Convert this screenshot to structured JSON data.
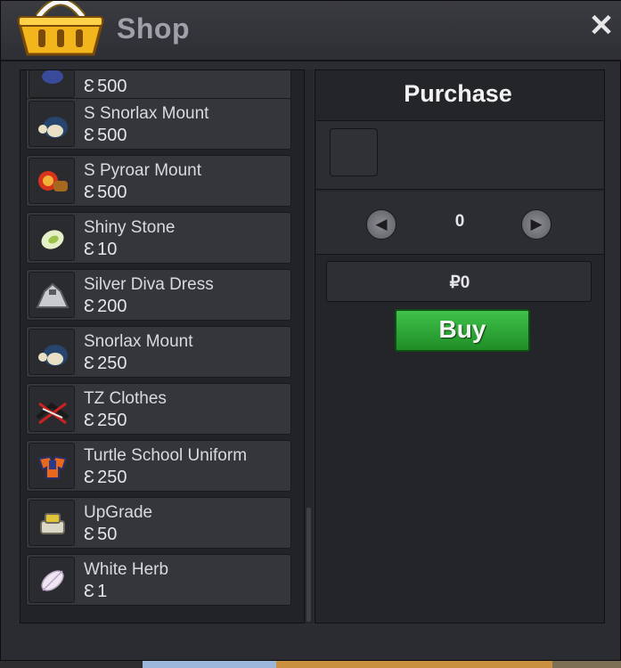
{
  "window": {
    "title": "Shop",
    "close_label": "✕"
  },
  "items": [
    {
      "name": "",
      "currency": "Ɛ",
      "price": "500",
      "icon": "pokemon-partial-icon"
    },
    {
      "name": "S Snorlax Mount",
      "currency": "Ɛ",
      "price": "500",
      "icon": "snorlax-icon"
    },
    {
      "name": "S Pyroar Mount",
      "currency": "Ɛ",
      "price": "500",
      "icon": "pyroar-icon"
    },
    {
      "name": "Shiny Stone",
      "currency": "Ɛ",
      "price": "10",
      "icon": "shiny-stone-icon"
    },
    {
      "name": "Silver Diva Dress",
      "currency": "Ɛ",
      "price": "200",
      "icon": "dress-icon"
    },
    {
      "name": "Snorlax Mount",
      "currency": "Ɛ",
      "price": "250",
      "icon": "snorlax-icon"
    },
    {
      "name": "TZ Clothes",
      "currency": "Ɛ",
      "price": "250",
      "icon": "clothes-icon"
    },
    {
      "name": "Turtle School Uniform",
      "currency": "Ɛ",
      "price": "250",
      "icon": "uniform-icon"
    },
    {
      "name": "UpGrade",
      "currency": "Ɛ",
      "price": "50",
      "icon": "upgrade-icon"
    },
    {
      "name": "White Herb",
      "currency": "Ɛ",
      "price": "1",
      "icon": "white-herb-icon"
    }
  ],
  "purchase": {
    "title": "Purchase",
    "quantity": "0",
    "total": "₽0",
    "buy_label": "Buy",
    "left_arrow": "◀",
    "right_arrow": "▶"
  },
  "colors": {
    "buy_green": "#2aa833",
    "panel": "#2b2c31"
  }
}
